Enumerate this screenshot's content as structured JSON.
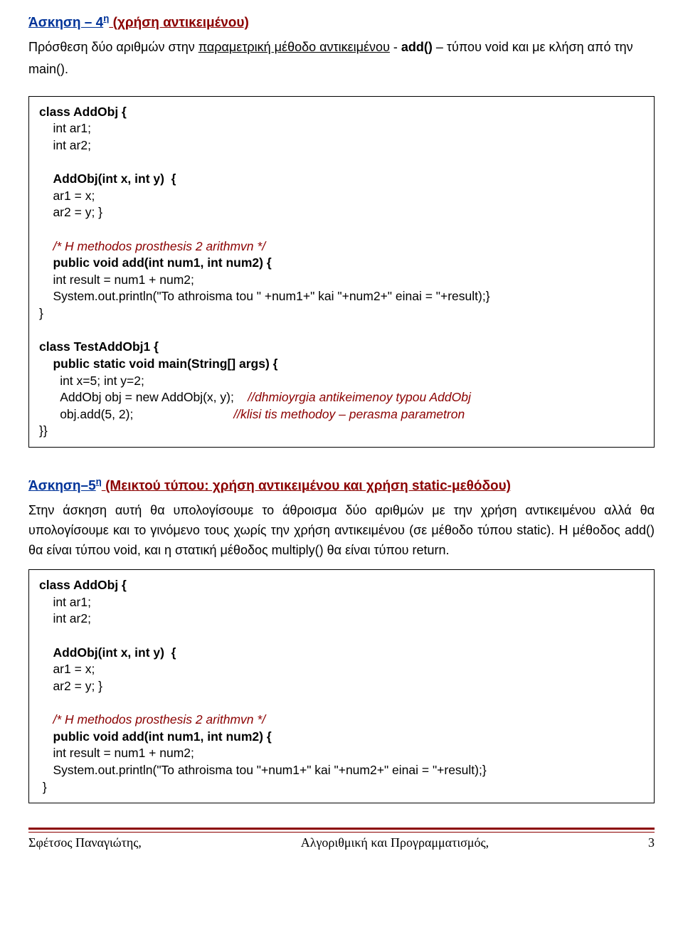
{
  "ex4": {
    "title_lead": "Άσκηση – 4",
    "title_sup": "η",
    "title_paren": " (χρήση αντικειμένου)",
    "intro_part1": "Πρόσθεση δύο αριθμών στην ",
    "intro_u": "παραμετρική μέθοδο αντικειμένου",
    "intro_part2": " - ",
    "intro_b1": "add()",
    "intro_part3": " – τύπου void  και με κλήση από την main()."
  },
  "code1": {
    "l1": "class AddObj {",
    "l2": "    int ar1;",
    "l3": "    int ar2;",
    "l4": "",
    "l5": "    AddObj(int x, int y)  {",
    "l6": "    ar1 = x;",
    "l7": "    ar2 = y; }",
    "l8": "",
    "l9": "    /* H methodos prosthesis 2 arithmvn */",
    "l10": "    public void add(int num1, int num2) {",
    "l11": "    int result = num1 + num2;",
    "l12": "    System.out.println(\"To athroisma tou \" +num1+\" kai \"+num2+\" einai = \"+result);}",
    "l13": "}",
    "l14": "",
    "l15": "class TestAddObj1 {",
    "l16": "    public static void main(String[] args) {",
    "l17": "      int x=5; int y=2;",
    "l18a": "      AddObj obj = new AddObj(x, y);    ",
    "l18b": "//dhmioyrgia antikeimenoy typou AddObj",
    "l19a": "      obj.add(5, 2);                             ",
    "l19b": "//klisi tis methodoy – perasma parametron",
    "l20": "}}"
  },
  "ex5": {
    "title_lead": "Άσκηση–5",
    "title_sup": "η",
    "title_mid": " (Μεικτού τύπου:  χρήση αντικειμένου και χρήση static-μεθόδου)",
    "body": "Στην άσκηση αυτή θα υπολογίσουμε το άθροισμα δύο αριθμών με την χρήση αντικειμένου αλλά θα υπολογίσουμε και το γινόμενο τους χωρίς την χρήση αντικειμένου (σε μέθοδο τύπου static). Η μέθοδος add() θα είναι τύπου void, και η στατική μέθοδος multiply() θα είναι τύπου return."
  },
  "code2": {
    "l1": "class AddObj {",
    "l2": "    int ar1;",
    "l3": "    int ar2;",
    "l4": "",
    "l5": "    AddObj(int x, int y)  {",
    "l6": "    ar1 = x;",
    "l7": "    ar2 = y; }",
    "l8": "",
    "l9": "    /* H methodos prosthesis 2 arithmvn */",
    "l10": "    public void add(int num1, int num2) {",
    "l11": "    int result = num1 + num2;",
    "l12": "    System.out.println(\"To athroisma tou \"+num1+\" kai \"+num2+\" einai = \"+result);}",
    "l13": " }"
  },
  "footer": {
    "left": "Σφέτσος  Παναγιώτης,",
    "center": "Αλγοριθμική και Προγραμματισμός,",
    "right": "3"
  }
}
